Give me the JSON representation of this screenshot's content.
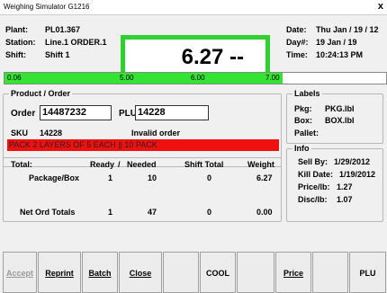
{
  "window": {
    "title": "Weighing Simulator  G1216",
    "close_glyph": "x"
  },
  "header": {
    "plant_label": "Plant:",
    "plant_value": "PL01.367",
    "station_label": "Station:",
    "station_value": "Line.1 ORDER.1",
    "shift_label": "Shift:",
    "shift_value": "Shift 1",
    "date_label": "Date:",
    "date_value": "Thu Jan / 19 / 12",
    "day_label": "Day#:",
    "day_value": "19   Jan / 19",
    "time_label": "Time:",
    "time_value": "10:24:13 PM"
  },
  "weight_display": {
    "value": "6.27 --",
    "border_color": "#2fd12f"
  },
  "weight_bar": {
    "labels": [
      "0.06",
      "5.00",
      "6.00",
      "7.00"
    ],
    "fill_color": "#33e433"
  },
  "product": {
    "legend": "Product / Order",
    "order_label": "Order",
    "order_value": "14487232",
    "plu_label": "PLU",
    "plu_value": "14228",
    "sku_label": "SKU",
    "sku_value": "14228",
    "status": "Invalid order",
    "banner": "PACK 2 LAYERS OF 5 EACH || 10 PACK",
    "banner_color": "#f01010"
  },
  "labels": {
    "legend": "Labels",
    "pkg_label": "Pkg:",
    "pkg_value": "PKG.lbl",
    "box_label": "Box:",
    "box_value": "BOX.lbl",
    "pallet_label": "Pallet:"
  },
  "totals": {
    "header": [
      "Total:",
      "Ready",
      "/",
      "Needed",
      "Shift Total",
      "Weight"
    ],
    "rows": [
      {
        "name": "Package/Box",
        "ready": "1",
        "needed": "10",
        "shift": "0",
        "weight": "6.27"
      },
      {
        "name": "Net Ord Totals",
        "ready": "1",
        "needed": "47",
        "shift": "0",
        "weight": "0.00"
      }
    ]
  },
  "info": {
    "legend": "Info",
    "sellby_label": "Sell By:",
    "sellby_value": "1/29/2012",
    "kill_label": "Kill Date:",
    "kill_value": "1/19/2012",
    "price_label": "Price/lb:",
    "price_value": "1.27",
    "disc_label": "Disc/lb:",
    "disc_value": "1.07"
  },
  "buttons": {
    "accept": "Accept",
    "reprint": "Reprint",
    "batch": "Batch",
    "close": "Close",
    "cool": "COOL",
    "price": "Price",
    "plu": "PLU"
  }
}
